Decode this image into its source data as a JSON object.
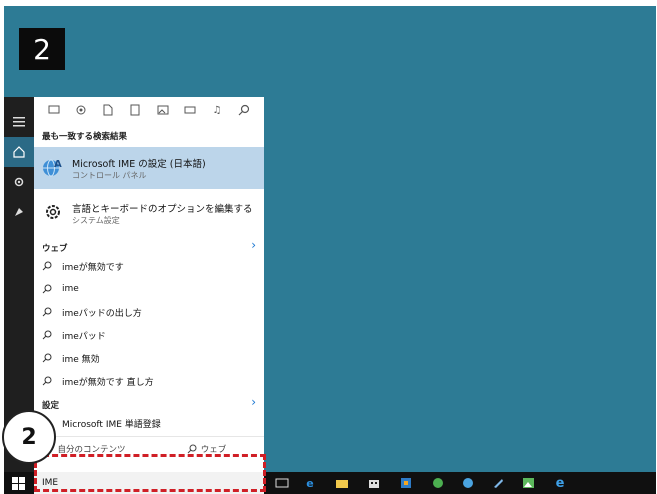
{
  "step_badge": "2",
  "callout_number": "2",
  "best_match": {
    "heading": "最も一致する検索結果",
    "title": "Microsoft IME の設定 (日本語)",
    "subtitle": "コントロール パネル"
  },
  "second_result": {
    "title": "言語とキーボードのオプションを編集する",
    "subtitle": "システム設定"
  },
  "web": {
    "heading": "ウェブ",
    "items": [
      "imeが無効です",
      "ime",
      "imeパッドの出し方",
      "imeパッド",
      "ime 無効",
      "imeが無効です 直し方"
    ]
  },
  "settings": {
    "heading": "設定",
    "item": "Microsoft IME 単語登録"
  },
  "bottom": {
    "my_stuff": "自分のコンテンツ",
    "web": "ウェブ"
  },
  "search_input": {
    "value": "IME"
  },
  "colors": {
    "desktop": "#2d7b95",
    "highlight": "#bcd5ea",
    "annotation": "#d01f26"
  }
}
